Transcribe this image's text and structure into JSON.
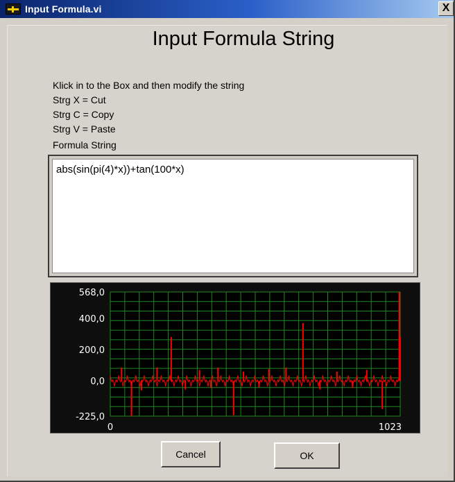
{
  "window": {
    "title": "Input Formula.vi",
    "close_label": "X"
  },
  "heading": "Input Formula String",
  "instructions": [
    "Klick in  to the Box and then modify the string",
    "Strg X = Cut",
    "Strg C = Copy",
    "Strg V = Paste"
  ],
  "formula_label": "Formula String",
  "formula_value": "abs(sin(pi(4)*x))+tan(100*x)",
  "buttons": {
    "cancel": "Cancel",
    "ok": "OK"
  },
  "colors": {
    "plot_line": "#ff0000",
    "grid": "#1f8a1f",
    "plot_bg": "#000000"
  },
  "chart_data": {
    "type": "line",
    "title": "",
    "xlabel": "",
    "ylabel": "",
    "xlim": [
      0,
      1023
    ],
    "ylim": [
      -225,
      568
    ],
    "y_ticks": [
      "568,0",
      "400,0",
      "200,0",
      "0,0",
      "-225,0"
    ],
    "x_ticks": [
      "0",
      "1023"
    ],
    "grid": true,
    "series": [
      {
        "spikes": [
          [
            40,
            85
          ],
          [
            75,
            -225
          ],
          [
            110,
            -60
          ],
          [
            165,
            85
          ],
          [
            215,
            280
          ],
          [
            265,
            -55
          ],
          [
            315,
            70
          ],
          [
            355,
            -45
          ],
          [
            380,
            85
          ],
          [
            435,
            -220
          ],
          [
            470,
            60
          ],
          [
            525,
            -40
          ],
          [
            560,
            75
          ],
          [
            620,
            85
          ],
          [
            680,
            370
          ],
          [
            740,
            -55
          ],
          [
            800,
            60
          ],
          [
            855,
            -45
          ],
          [
            905,
            70
          ],
          [
            960,
            -180
          ],
          [
            1020,
            568
          ],
          [
            1023,
            280
          ]
        ],
        "amplitude": 35
      }
    ]
  }
}
